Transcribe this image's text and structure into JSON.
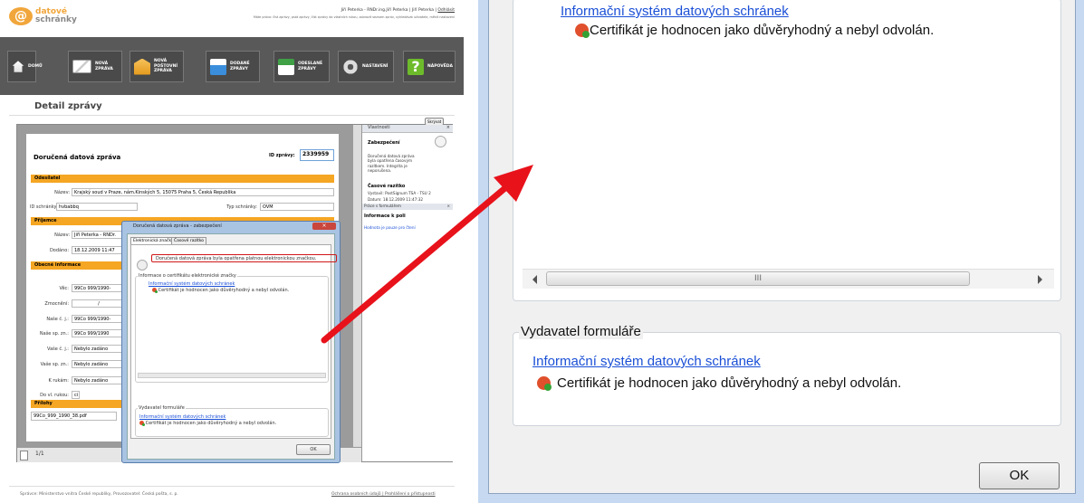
{
  "header": {
    "logo_text_line1": "datové",
    "logo_text_line2": "schránky",
    "user_line": "Jiří Peterka - RNDr.ing.Jiří Peterka | Jiří Peterka |",
    "logout_label": "Odhlásit",
    "permissions_line1": "Máte právo: číst zprávy, psát zprávy, číst zprávy do vlastních rukou, zobrazit seznam zpráv, vyhledávat uživatele, měnit nastavení"
  },
  "nav": {
    "items": [
      {
        "label": "DOMŮ",
        "icon": "home-icon"
      },
      {
        "label": "NOVÁ ZPRÁVA",
        "icon": "envelope-icon"
      },
      {
        "label": "NOVÁ POŠTOVNÍ ZPRÁVA",
        "icon": "mail-icon"
      },
      {
        "label": "DODANÉ ZPRÁVY",
        "icon": "inbox-icon"
      },
      {
        "label": "ODESLANÉ ZPRÁVY",
        "icon": "outbox-icon"
      },
      {
        "label": "NASTAVENÍ",
        "icon": "gears-icon"
      },
      {
        "label": "NÁPOVĚDA",
        "icon": "help-icon"
      }
    ]
  },
  "page_title": "Detail zprávy",
  "show_label": "Skrývat",
  "message": {
    "title": "Doručená datová zpráva",
    "id_label": "ID zprávy:",
    "id_value": "2339959",
    "sender_section": "Odesílatel",
    "name_label": "Název:",
    "name_value": "Krajský soud v Praze, nám.Kinských 5, 15075 Praha 5, Česká Republika",
    "box_id_label": "ID schránky:",
    "box_id_value": "hvbabbq",
    "box_type_label": "Typ schránky:",
    "box_type_value": "OVM",
    "recipient_section": "Příjemce",
    "recipient_name_value": "Jiří Peterka - RNDr.",
    "delivered_label": "Dodáno:",
    "delivered_value": "18.12.2009 11:47",
    "general_section": "Obecné informace",
    "fields": [
      {
        "label": "Věc:",
        "value": "99Co 999/1990-"
      },
      {
        "label": "Zmocnění:",
        "value": "/"
      },
      {
        "label": "Naše č. j.:",
        "value": "99Co 999/1990-"
      },
      {
        "label": "Naše sp. zn.:",
        "value": "99Co 999/1990"
      },
      {
        "label": "Vaše č. j.:",
        "value": "Nebylo zadáno"
      },
      {
        "label": "Vaše sp. zn.:",
        "value": "Nebylo zadáno"
      },
      {
        "label": "K rukám:",
        "value": "Nebylo zadáno"
      },
      {
        "label": "Do vl. rukou:",
        "value": "ci"
      }
    ],
    "attachments_section": "Přílohy",
    "attachment": "99Co_999_1990_38.pdf",
    "pager": "1/1"
  },
  "properties": {
    "title": "Vlastnosti",
    "security_title": "Zabezpečení",
    "security_text": "Doručená datová zpráva byla opatřena časovým razítkem. Integrita je neporušena.",
    "timestamp_title": "Časové razítko",
    "issuer_line": "Vystavil: PostSignum TSA - TSU 2",
    "date_line": "Datum: 18.12.2009 11:47:32",
    "form_work": "Práce s formulářem",
    "field_info": "Informace k poli",
    "read_only": "Hodnota je pouze pro čtení"
  },
  "dialog": {
    "title": "Doručená datová zpráva - zabezpečení",
    "tab1": "Elektronická značka",
    "tab2": "Časové razítko",
    "sealed_text": "Doručená datová zpráva byla opatřena platnou elektronickou značkou.",
    "cert_info": "Informace o certifikátu elektronické značky",
    "system_link": "Informační systém datových schránek",
    "cert_status": "Certifikát je hodnocen jako důvěryhodný a nebyl odvolán.",
    "form_issuer": "Vydavatel formuláře",
    "ok": "OK"
  },
  "zoom": {
    "system_link": "Informační systém datových schránek",
    "cert_status": "Certifikát je hodnocen jako důvěryhodný a nebyl odvolán.",
    "scroll_grip": "III",
    "form_issuer": "Vydavatel formuláře",
    "system_link2": "Informační systém datových schránek",
    "cert_status2": "Certifikát je hodnocen jako důvěryhodný a nebyl odvolán.",
    "ok": "OK"
  },
  "footer": {
    "left": "Správce: Ministerstvo vnitra České republiky, Provozovatel: Česká pošta, s. p.",
    "right": "Ochrana osobních údajů | Prohlášení o přístupnosti"
  },
  "colors": {
    "accent": "#f5a623",
    "nav_bg": "#595959",
    "arrow": "#e8121b",
    "link": "#1a4fd6"
  }
}
